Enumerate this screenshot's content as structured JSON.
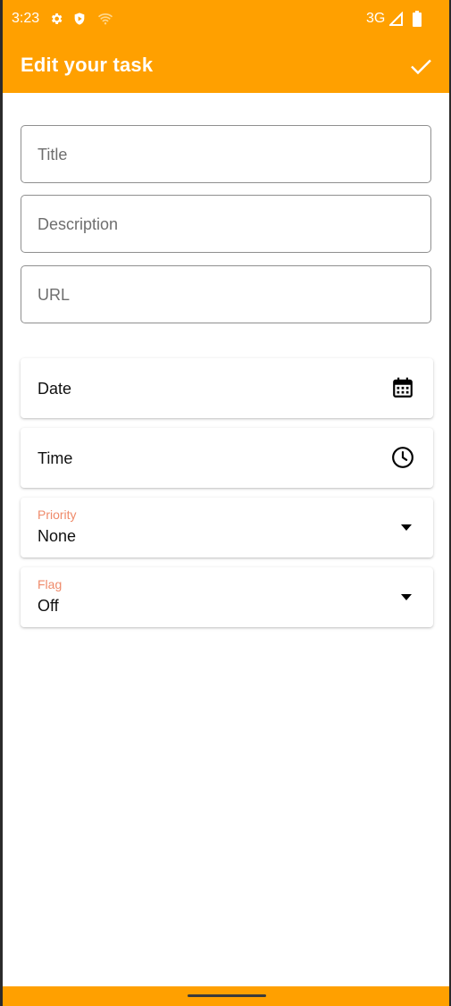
{
  "status_bar": {
    "time": "3:23",
    "network": "3G",
    "icons": [
      "gear-icon",
      "shield-icon",
      "wifi-icon",
      "signal-icon",
      "battery-icon"
    ]
  },
  "app_bar": {
    "title": "Edit your task",
    "action_icon": "check-icon",
    "background": "#ffa000"
  },
  "form": {
    "title_placeholder": "Title",
    "description_placeholder": "Description",
    "url_placeholder": "URL",
    "date_label": "Date",
    "time_label": "Time",
    "priority": {
      "caption": "Priority",
      "value": "None"
    },
    "flag": {
      "caption": "Flag",
      "value": "Off"
    }
  },
  "colors": {
    "accent": "#ffa000",
    "caption": "#ef8a6a"
  }
}
